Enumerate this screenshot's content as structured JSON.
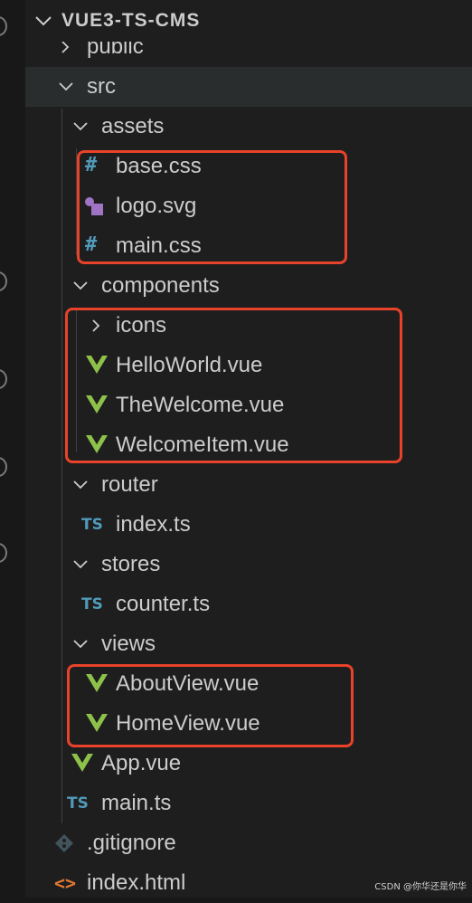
{
  "explorer": {
    "title": "VUE3-TS-CMS"
  },
  "tree": {
    "public": "public",
    "src": "src",
    "assets": "assets",
    "base_css": "base.css",
    "logo_svg": "logo.svg",
    "main_css": "main.css",
    "components": "components",
    "icons": "icons",
    "hello_world": "HelloWorld.vue",
    "the_welcome": "TheWelcome.vue",
    "welcome_item": "WelcomeItem.vue",
    "router": "router",
    "router_index": "index.ts",
    "stores": "stores",
    "counter": "counter.ts",
    "views": "views",
    "about_view": "AboutView.vue",
    "home_view": "HomeView.vue",
    "app_vue": "App.vue",
    "main_ts": "main.ts",
    "gitignore": ".gitignore",
    "index_html": "index.html"
  },
  "icons": {
    "css": "#",
    "ts": "TS",
    "html": "<>"
  },
  "colors": {
    "highlight_border": "#e8432a",
    "vue_green": "#8dc149",
    "ts_blue": "#519aba",
    "svg_purple": "#a074c4"
  },
  "watermark": "CSDN @你华还是你华"
}
